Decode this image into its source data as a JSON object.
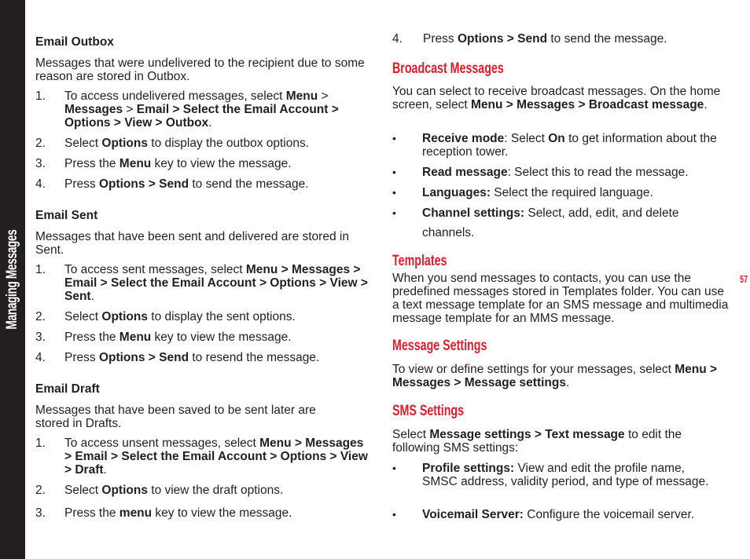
{
  "side_tab": {
    "label": "Managing Messages"
  },
  "page_number": "57",
  "left": {
    "outbox": {
      "heading": "Email Outbox",
      "intro": "Messages that were undelivered to the recipient due to some reason are stored in Outbox.",
      "steps": [
        {
          "num": "1.",
          "parts": [
            "To access undelivered messages, select ",
            "Menu",
            " > ",
            "Messages",
            " > ",
            "Email > Select the Email Account > Options > View > Outbox",
            "."
          ]
        },
        {
          "num": "2.",
          "parts": [
            "Select ",
            "Options",
            " to display the outbox options."
          ]
        },
        {
          "num": "3.",
          "parts": [
            "Press the ",
            "Menu",
            " key to view the message."
          ]
        },
        {
          "num": "4.",
          "parts": [
            "Press ",
            "Options > Send",
            " to send the message."
          ]
        }
      ]
    },
    "sent": {
      "heading": "Email Sent",
      "intro": "Messages that have been sent and delivered are stored in Sent.",
      "steps": [
        {
          "num": "1.",
          "parts": [
            "To access sent messages, select ",
            "Menu > Messages > Email > Select the Email Account > Options > View > Sent",
            "."
          ]
        },
        {
          "num": "2.",
          "parts": [
            "Select ",
            "Options",
            " to display the sent options."
          ]
        },
        {
          "num": "3.",
          "parts": [
            "Press the ",
            "Menu",
            " key to view the message."
          ]
        },
        {
          "num": "4.",
          "parts": [
            "Press ",
            "Options > Send",
            " to resend the message."
          ]
        }
      ]
    },
    "draft": {
      "heading": "Email Draft",
      "intro": "Messages that have been saved to be sent later are stored in Drafts.",
      "steps": [
        {
          "num": "1.",
          "parts": [
            "To access unsent messages, select ",
            "Menu > Messages > Email > Select the Email Account > Options > View > Draft",
            "."
          ]
        },
        {
          "num": "2.",
          "parts": [
            "Select ",
            "Options",
            " to view the draft options."
          ]
        },
        {
          "num": "3.",
          "parts": [
            "Press the ",
            "menu",
            " key to view the message."
          ]
        }
      ]
    }
  },
  "right": {
    "continued_step": {
      "num": "4.",
      "parts": [
        "Press ",
        "Options > Send",
        " to send the message."
      ]
    },
    "broadcast": {
      "heading": "Broadcast Messages",
      "intro_parts": [
        "You can select to receive broadcast messages. On the home screen, select ",
        "Menu > Messages > Broadcast message",
        "."
      ],
      "bullets": [
        {
          "parts": [
            "Receive mode",
            ": Select ",
            "On",
            " to get information about the reception tower."
          ]
        },
        {
          "parts": [
            "Read message",
            ": Select this to read the message."
          ]
        },
        {
          "parts": [
            "Languages:",
            " Select the required language."
          ]
        },
        {
          "parts": [
            "Channel settings:",
            " Select, add, edit, and delete"
          ],
          "continuation": "channels."
        }
      ]
    },
    "templates": {
      "heading": "Templates",
      "body": "When you send messages to contacts, you can use the predefined messages stored in Templates folder. You can use a text message template for an SMS message and multimedia message template for an MMS message."
    },
    "message_settings": {
      "heading": "Message Settings",
      "intro_parts": [
        "To view or define settings for your messages, select ",
        "Menu > Messages > Message settings",
        "."
      ]
    },
    "sms_settings": {
      "heading": "SMS Settings",
      "intro_parts": [
        "Select ",
        "Message settings > Text message",
        " to edit the following SMS settings:"
      ],
      "bullets": [
        {
          "parts": [
            "Profile settings:",
            " View and edit the profile name, SMSC address, validity period, and type of message."
          ]
        },
        {
          "parts": [
            "Voicemail Server:",
            " Configure the voicemail server."
          ]
        }
      ]
    }
  }
}
